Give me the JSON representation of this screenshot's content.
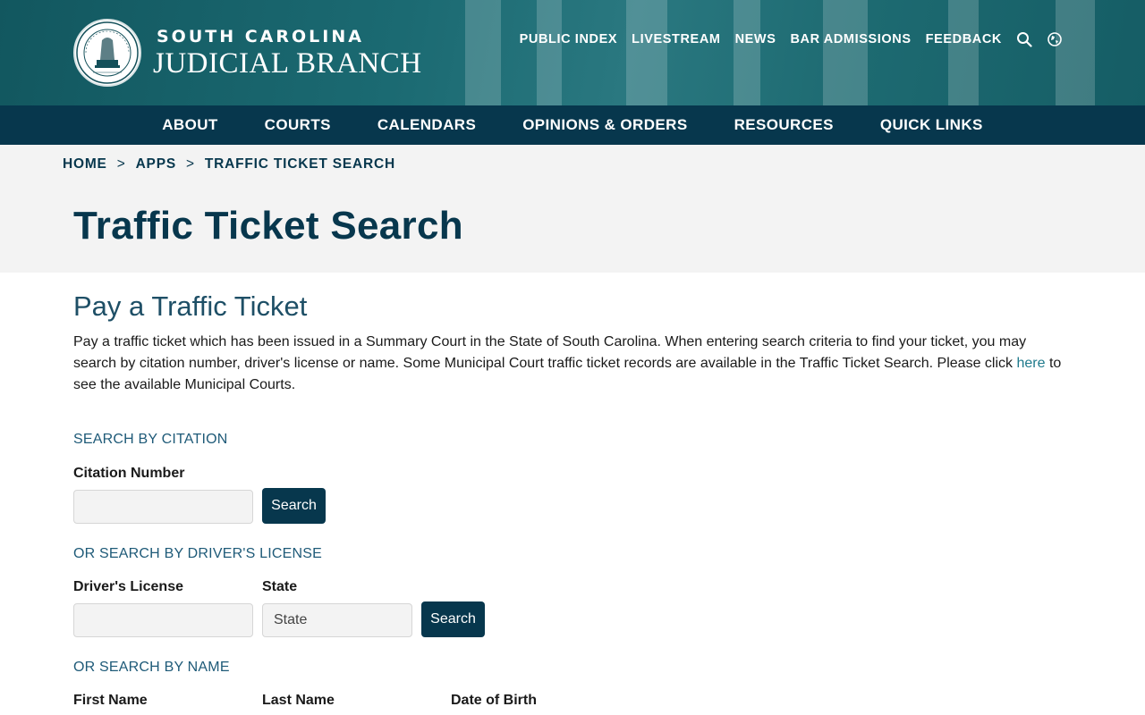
{
  "header": {
    "brand_line1": "SOUTH CAROLINA",
    "brand_line2": "JUDICIAL BRANCH",
    "seal_text_outer": "SUPREME COURT OF SOUTH CAROLINA",
    "seal_text_inner": "NIL ULTRA",
    "utility_links": [
      "PUBLIC INDEX",
      "LIVESTREAM",
      "NEWS",
      "BAR ADMISSIONS",
      "FEEDBACK"
    ],
    "icons": [
      "search-icon",
      "globe-icon"
    ]
  },
  "main_nav": {
    "items": [
      "ABOUT",
      "COURTS",
      "CALENDARS",
      "OPINIONS & ORDERS",
      "RESOURCES",
      "QUICK LINKS"
    ]
  },
  "breadcrumb": {
    "items": [
      "HOME",
      "APPS",
      "TRAFFIC TICKET SEARCH"
    ],
    "separator": ">"
  },
  "page": {
    "title": "Traffic Ticket Search",
    "section_heading": "Pay a Traffic Ticket",
    "intro_text": "Pay a traffic ticket which has been issued in a Summary Court in the State of South Carolina. When entering search criteria to find your ticket, you may search by citation number, driver's license or name. Some Municipal Court traffic ticket records are available in the Traffic Ticket Search.  Please click ",
    "intro_link": "here",
    "intro_text_after": " to see the available Municipal Courts."
  },
  "citation_search": {
    "heading": "SEARCH BY CITATION",
    "label": "Citation Number",
    "value": "",
    "button": "Search"
  },
  "license_search": {
    "heading": "OR SEARCH BY DRIVER'S LICENSE",
    "license_label": "Driver's License",
    "license_value": "",
    "state_label": "State",
    "state_value": "State",
    "button": "Search"
  },
  "name_search": {
    "heading": "OR SEARCH BY NAME",
    "first_name_label": "First Name",
    "last_name_label": "Last Name",
    "dob_label": "Date of Birth"
  },
  "colors": {
    "header_teal": "#1b6a72",
    "nav_navy": "#07374d",
    "heading_blue": "#1e4f66",
    "link_teal": "#1f7a8c",
    "hero_grey": "#f3f3f3"
  }
}
